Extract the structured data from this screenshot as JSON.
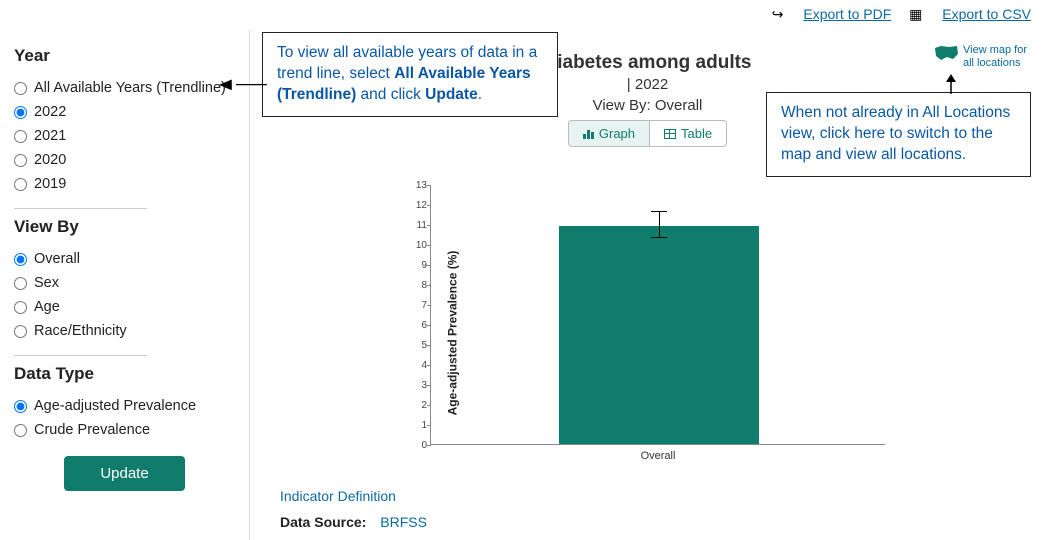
{
  "export": {
    "pdf": "Export to PDF",
    "csv": "Export to CSV"
  },
  "sidebar": {
    "year_heading": "Year",
    "years": [
      "All Available Years (Trendline)",
      "2022",
      "2021",
      "2020",
      "2019"
    ],
    "year_selected": 1,
    "viewby_heading": "View By",
    "viewby": [
      "Overall",
      "Sex",
      "Age",
      "Race/Ethnicity"
    ],
    "viewby_selected": 0,
    "datatype_heading": "Data Type",
    "datatypes": [
      "Age-adjusted Prevalence",
      "Crude Prevalence"
    ],
    "datatype_selected": 0,
    "update_label": "Update"
  },
  "header": {
    "title": "Diabetes among adults",
    "subtitle": "| 2022",
    "viewby_prefix": "View By: ",
    "viewby_value": "Overall",
    "graph_label": "Graph",
    "table_label": "Table",
    "map_link_line1": "View map for",
    "map_link_line2": "all locations"
  },
  "callouts": {
    "c1_part1": "To view all available years of data in a trend line, select ",
    "c1_bold1": "All Available Years (Trendline)",
    "c1_part2": " and click ",
    "c1_bold2": "Update",
    "c1_part3": ".",
    "c2": "When not already in All Locations view, click here to switch to the map and view all locations."
  },
  "footer": {
    "indicator_def": "Indicator Definition",
    "data_source_label": "Data Source:",
    "data_source_value": "BRFSS"
  },
  "chart_data": {
    "type": "bar",
    "categories": [
      "Overall"
    ],
    "values": [
      10.9
    ],
    "error_low": [
      10.4
    ],
    "error_high": [
      11.7
    ],
    "title": "Diabetes among adults",
    "ylabel": "Age-adjusted Prevalence (%)",
    "xlabel": "",
    "ylim": [
      0,
      13
    ],
    "yticks": [
      0,
      1,
      2,
      3,
      4,
      5,
      6,
      7,
      8,
      9,
      10,
      11,
      12,
      13
    ]
  }
}
